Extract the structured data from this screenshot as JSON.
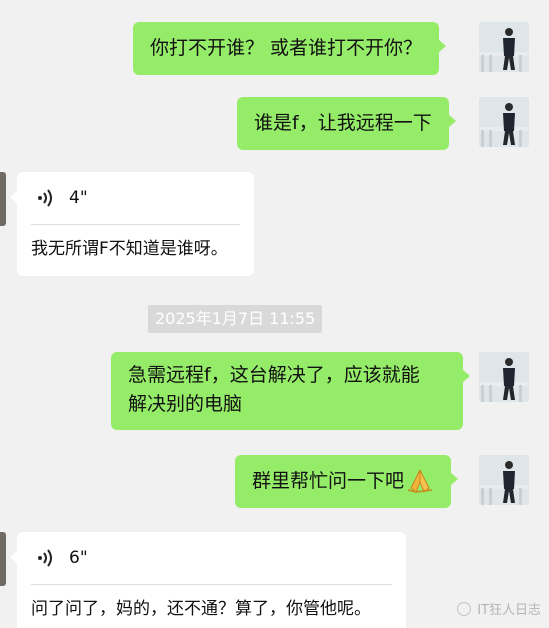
{
  "messages": [
    {
      "text": "你打不开谁？ 或者谁打不开你？"
    },
    {
      "text": "谁是f，让我远程一下"
    },
    {
      "duration": "4\"",
      "transcript": "我无所谓F不知道是谁呀。"
    },
    {
      "timestamp": "2025年1月7日 11:55"
    },
    {
      "text_line1": "急需远程f，这台解决了，应该就能",
      "text_line2": "解决别的电脑"
    },
    {
      "text": "群里帮忙问一下吧"
    },
    {
      "duration": "6\"",
      "transcript": "问了问了，妈的，还不通？算了，你管他呢。"
    }
  ],
  "watermark": "IT狂人日志",
  "colors": {
    "outgoing": "#95ec69",
    "incoming": "#ffffff",
    "background": "#f1f1f1"
  }
}
